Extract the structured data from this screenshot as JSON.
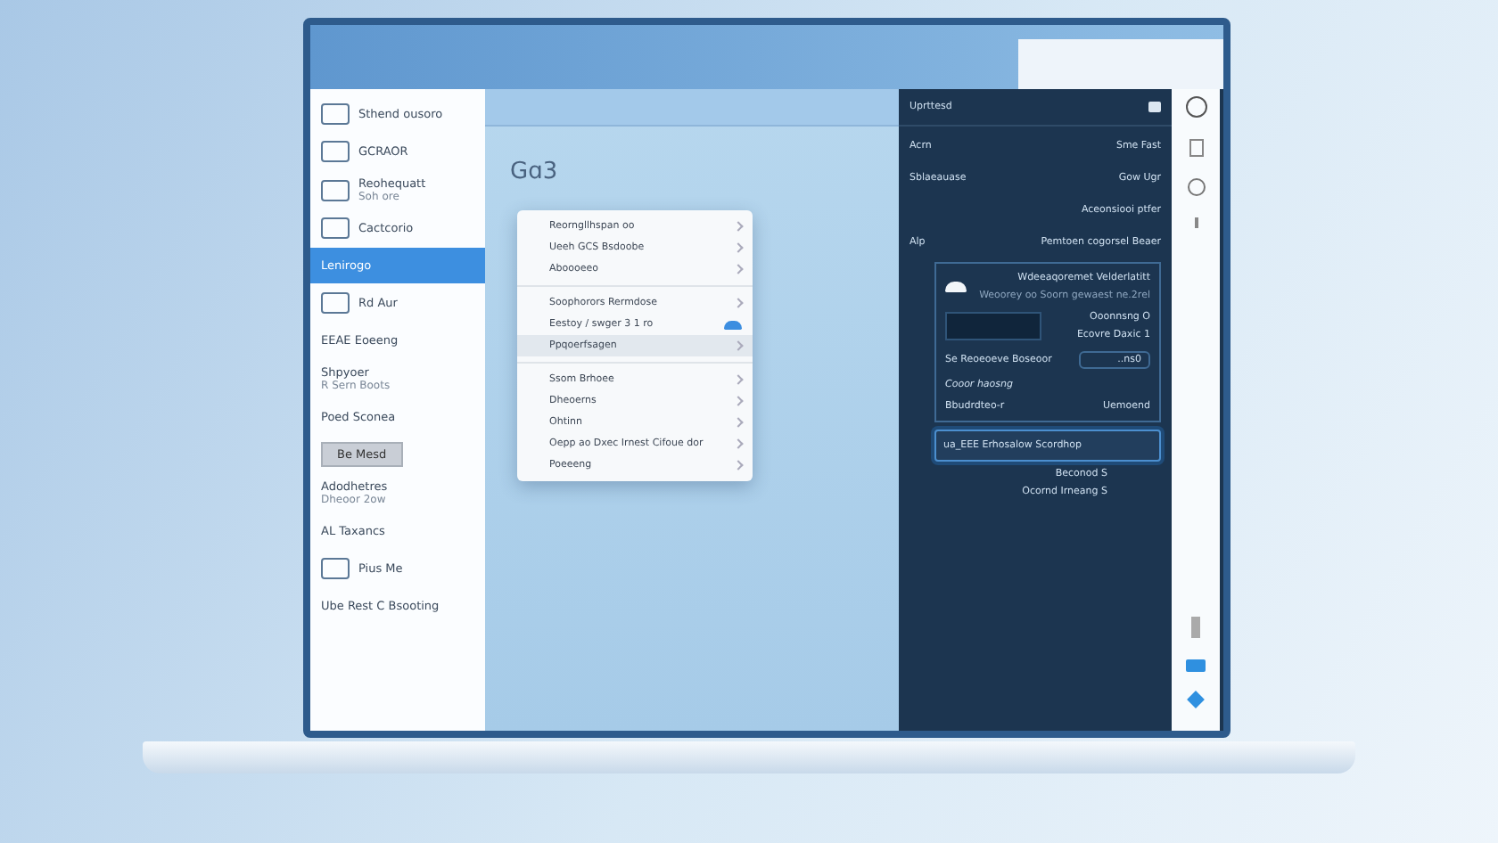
{
  "sidebar": {
    "items": [
      {
        "kind": "icon",
        "label": "Sthend ousoro",
        "selected": false
      },
      {
        "kind": "icon",
        "label": "GCRAOR",
        "selected": false
      },
      {
        "kind": "icon",
        "label": "Reohequatt",
        "sub": "Soh ore",
        "selected": false
      },
      {
        "kind": "icon",
        "label": "Cactcorio",
        "selected": false
      },
      {
        "kind": "plain",
        "label": "Lenirogo",
        "selected": true
      },
      {
        "kind": "icon",
        "label": "Rd Aur",
        "selected": false
      },
      {
        "kind": "plain",
        "label": "EEAE Eoeeng",
        "selected": false
      },
      {
        "kind": "plain",
        "label": "Shpyoer",
        "sub": "R Sern Boots",
        "selected": false
      },
      {
        "kind": "plain",
        "label": "Poed Sconea",
        "selected": false
      },
      {
        "kind": "button",
        "label": "Be Mesd",
        "selected": false
      },
      {
        "kind": "plain",
        "label": "Adodhetres",
        "sub": "Dheoor 2ow",
        "selected": false
      },
      {
        "kind": "plain",
        "label": "AL Taxancs",
        "selected": false
      },
      {
        "kind": "icon",
        "label": "Pius Me",
        "selected": false
      },
      {
        "kind": "plain",
        "label": "Ube Rest C Bsooting",
        "selected": false
      }
    ]
  },
  "main": {
    "title": "Gɑ3",
    "menu_groups": [
      {
        "items": [
          {
            "label": "Reorngllhspan oo",
            "selected": false
          },
          {
            "label": "Ueeh GCS Bsdoobe",
            "selected": false
          },
          {
            "label": "Aboooeeo",
            "selected": false
          }
        ]
      },
      {
        "items": [
          {
            "label": "Soophorors Rermdose",
            "selected": false
          },
          {
            "label": "Eestoy / swger 3 1 ro",
            "selected": false,
            "cloud": true
          },
          {
            "label": "Ppqoerfsagen",
            "selected": true
          }
        ]
      },
      {
        "items": [
          {
            "label": "Ssom Brhoee",
            "selected": false
          },
          {
            "label": "Dheoerns",
            "selected": false
          },
          {
            "label": "Ohtinn",
            "selected": false
          },
          {
            "label": "Oepp ao Dxec Irnest Cifoue dor",
            "selected": false
          },
          {
            "label": "Poeeeng",
            "selected": false
          }
        ]
      }
    ]
  },
  "panel": {
    "title": "Uprttesd",
    "rows": [
      {
        "left": "Acrn",
        "right": "Sme Fast"
      },
      {
        "left": "Sblaeauase",
        "right": "Gow Ugr"
      },
      {
        "right": "Aceonsiooi ptfer"
      },
      {
        "left": "Alp",
        "right": "Pemtoen cogorsel Beaer"
      }
    ],
    "card": {
      "title": "Wdeeaqoremet Velderlatitt",
      "subtitle": "Weoorey oo Soorn gewaest ne.2rel",
      "status": "Ooonnsng O",
      "status2": "Ecovre Daxic 1",
      "line": "Se Reoeoeve Boseoor",
      "field": "..ns0",
      "heading": "Cooor haosng",
      "note": "Bbudrdteo-r",
      "action": "Uemoend"
    },
    "selected_item": {
      "label": "ua_EEE Erhosalow Scordhop",
      "selected": true
    },
    "footer": [
      "Beconod S",
      "Ocornd Irneang S"
    ]
  }
}
